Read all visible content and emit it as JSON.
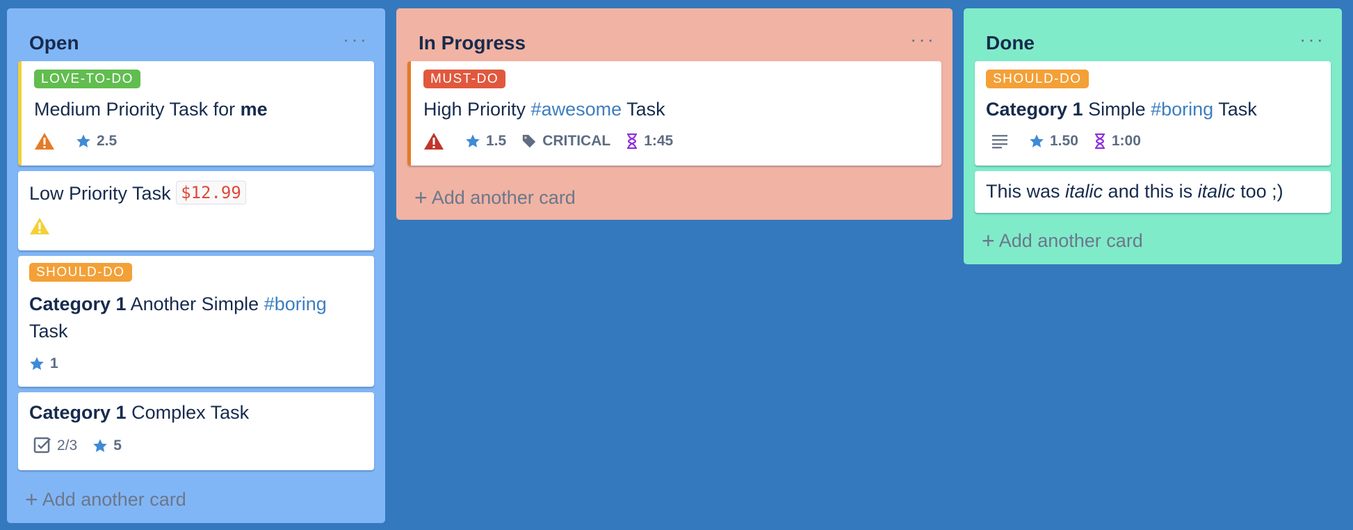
{
  "colors": {
    "board_bg": "#3479bd",
    "open_list": "#81b6f6",
    "progress_list": "#f1b3a3",
    "done_list": "#80ebc9",
    "label_love": "#61bd4f",
    "label_must": "#e0583e",
    "label_should": "#f3a037",
    "star": "#3e8ad8",
    "hourglass": "#8f2fdc"
  },
  "lists": [
    {
      "title": "Open",
      "menu": "···",
      "add_card": "Add another card",
      "cards": [
        {
          "label": "LOVE-TO-DO",
          "title_prefix": "Medium Priority Task for ",
          "title_bold": "me",
          "rating": "2.5"
        },
        {
          "title": "Low Priority Task",
          "price": "$12.99"
        },
        {
          "label": "SHOULD-DO",
          "category": "Category 1",
          "title_mid": " Another Simple ",
          "tag": "#boring",
          "title_end": "Task",
          "rating": "1"
        },
        {
          "category": "Category 1",
          "title_rest": " Complex Task",
          "checklist": "2/3",
          "rating": "5"
        }
      ]
    },
    {
      "title": "In Progress",
      "menu": "···",
      "add_card": "Add another card",
      "cards": [
        {
          "label": "MUST-DO",
          "title_start": "High Priority ",
          "tag": "#awesome",
          "title_end": " Task",
          "rating": "1.5",
          "tag_badge": "CRITICAL",
          "time": "1:45"
        }
      ]
    },
    {
      "title": "Done",
      "menu": "···",
      "add_card": "Add another card",
      "cards": [
        {
          "label": "SHOULD-DO",
          "category": "Category 1",
          "title_mid": " Simple ",
          "tag": "#boring",
          "title_end": " Task",
          "rating": "1.50",
          "time": "1:00"
        },
        {
          "text_a": "This was ",
          "italic_a": "italic",
          "text_b": " and this is ",
          "italic_b": "italic",
          "text_c": " too ;)"
        }
      ]
    }
  ]
}
